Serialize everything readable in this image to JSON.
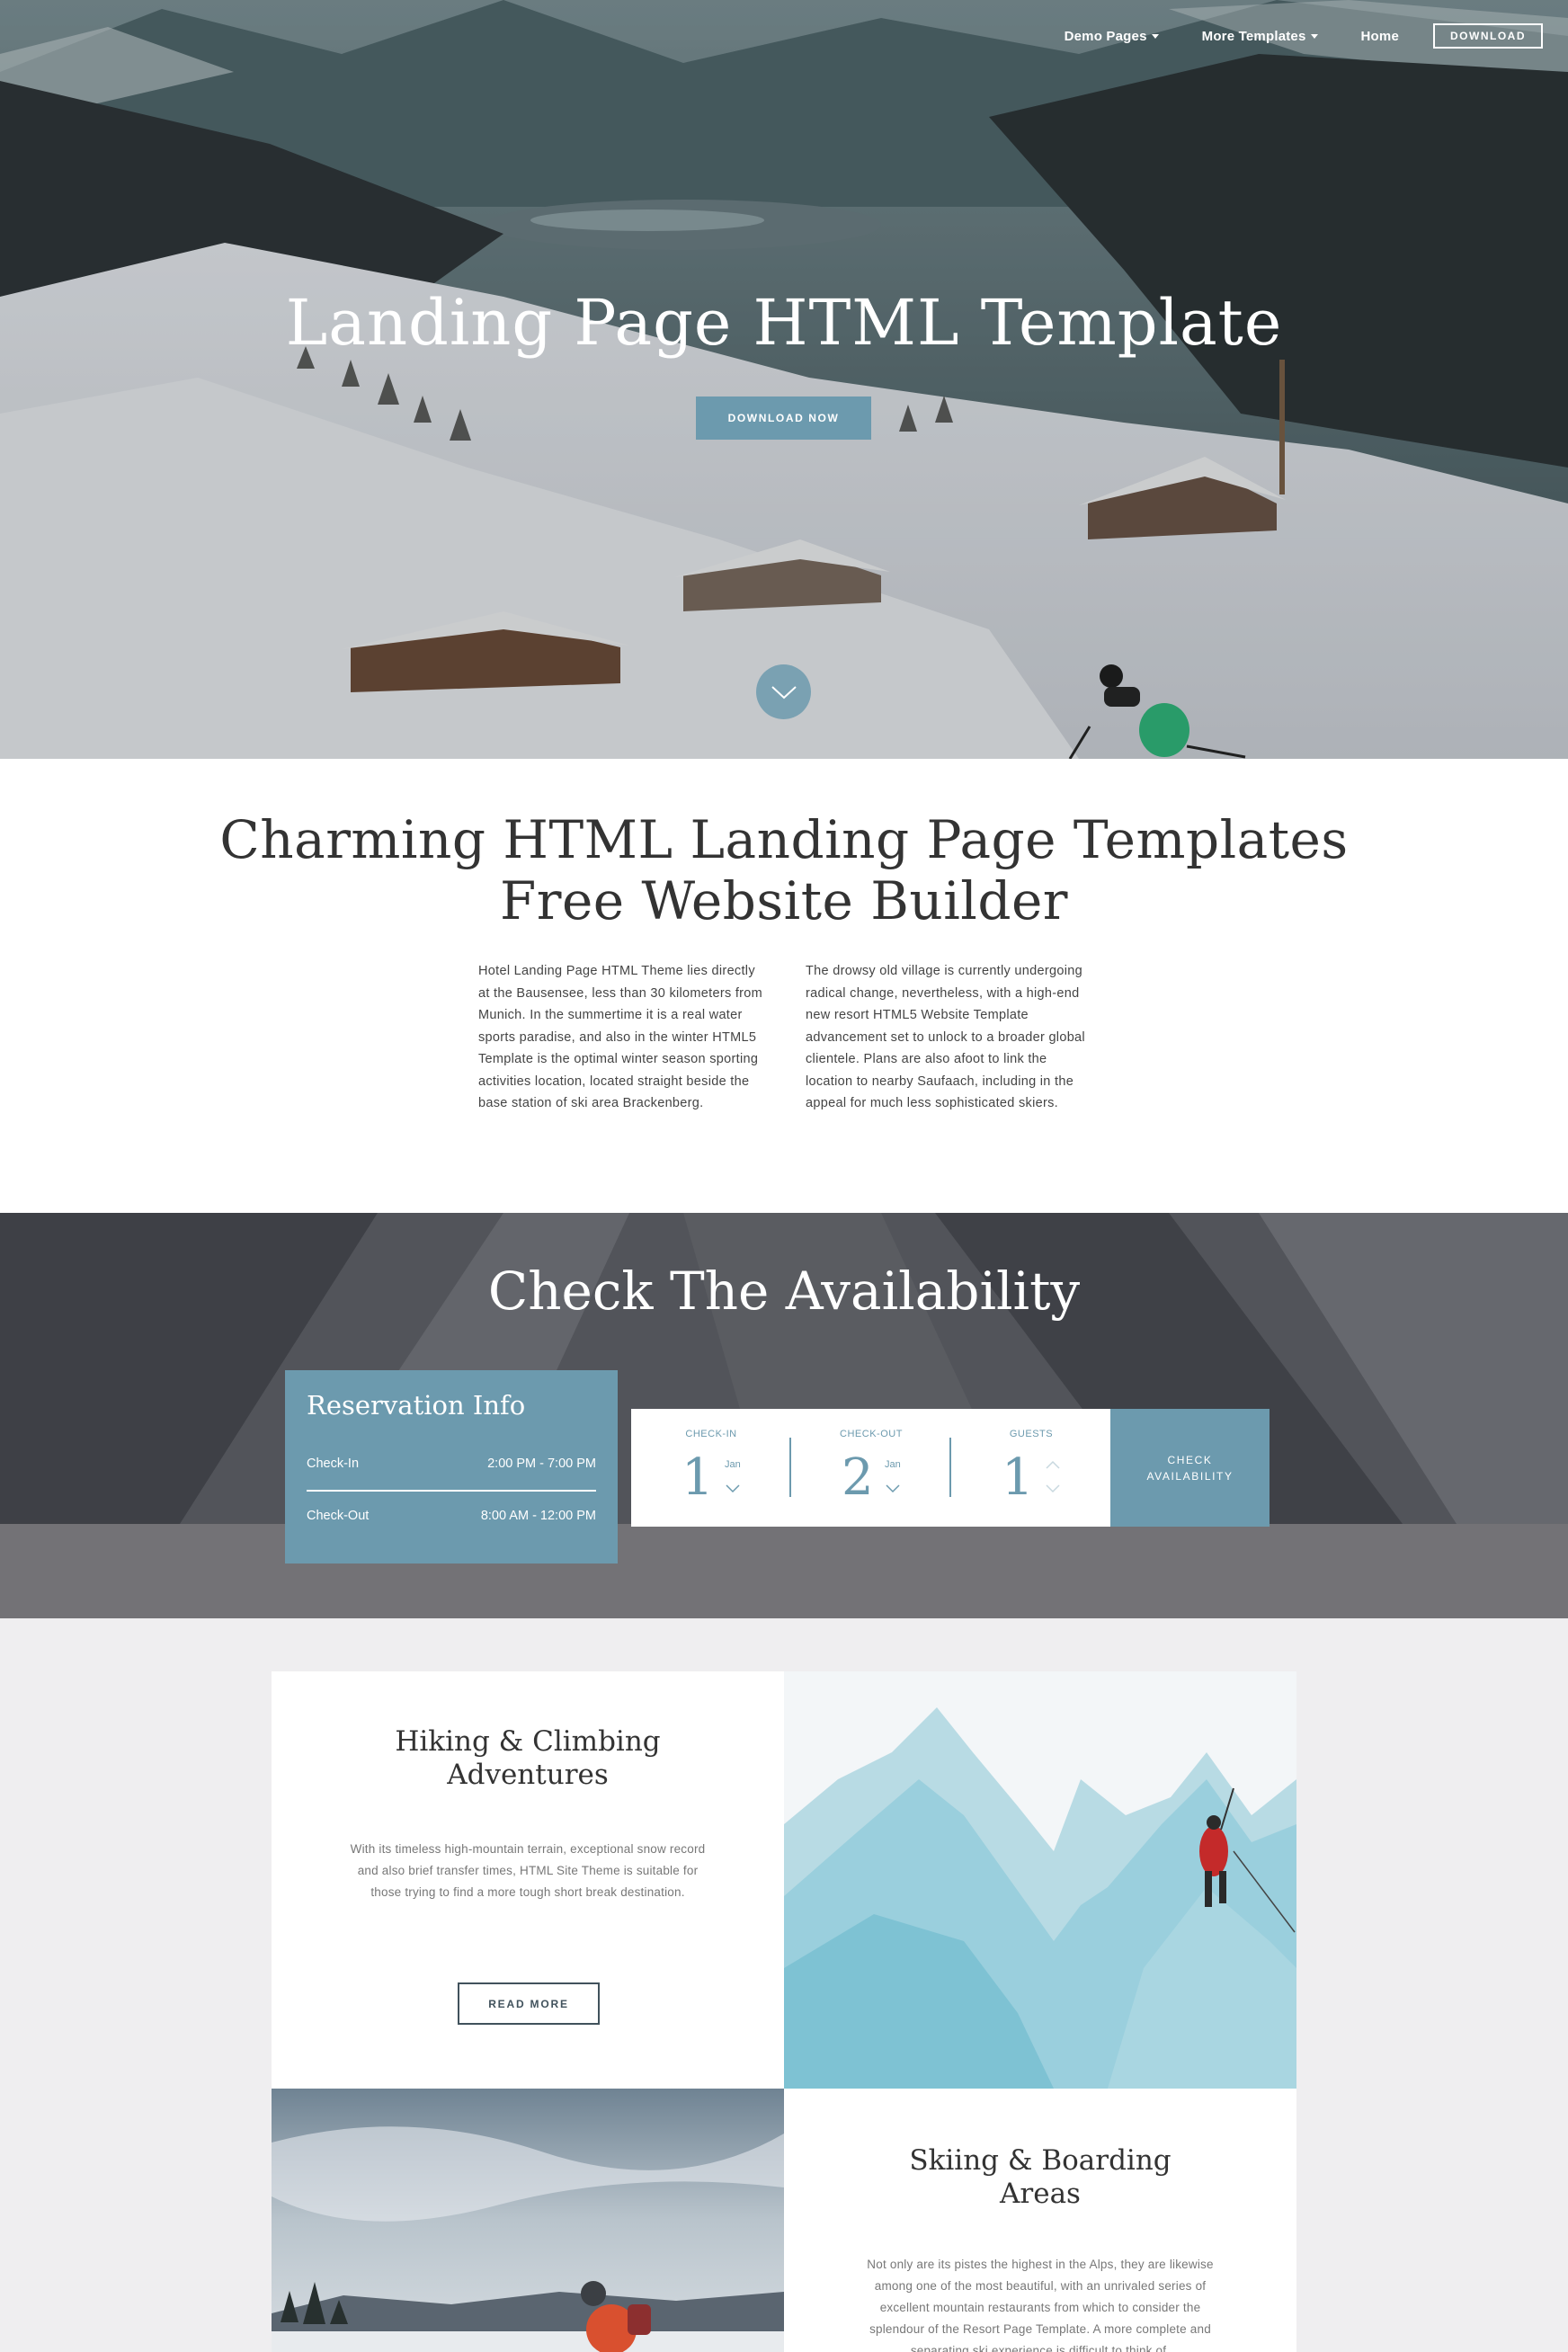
{
  "nav": {
    "items": [
      {
        "label": "Demo Pages",
        "has_caret": true
      },
      {
        "label": "More Templates",
        "has_caret": true
      },
      {
        "label": "Home",
        "has_caret": false
      }
    ],
    "download_label": "DOWNLOAD"
  },
  "hero": {
    "title": "Landing Page HTML Template",
    "button_label": "DOWNLOAD NOW",
    "scroll_icon": "chevron-down-icon"
  },
  "intro": {
    "title_line1": "Charming HTML Landing Page Templates",
    "title_line2": "Free Website Builder",
    "col_left": "Hotel Landing Page HTML Theme lies directly at the Bausensee, less than 30 kilometers from Munich. In the summertime it is a real water sports paradise, and also in the winter HTML5 Template is the optimal winter season sporting activities location, located straight beside the base station of ski area Brackenberg.",
    "col_right": "The drowsy old village is currently undergoing radical change, nevertheless, with a high-end new resort HTML5 Website Template advancement set to unlock to a broader global clientele. Plans are also afoot to link the location to nearby Saufaach, including in the appeal for much less sophisticated skiers."
  },
  "availability": {
    "title": "Check The Availability",
    "reservation": {
      "title": "Reservation Info",
      "checkin_label": "Check-In",
      "checkin_value": "2:00 PM - 7:00 PM",
      "checkout_label": "Check-Out",
      "checkout_value": "8:00 AM - 12:00 PM"
    },
    "form": {
      "checkin": {
        "label": "CHECK-IN",
        "day": "1",
        "month": "Jan"
      },
      "checkout": {
        "label": "CHECK-OUT",
        "day": "2",
        "month": "Jan"
      },
      "guests": {
        "label": "GUESTS",
        "value": "1"
      }
    },
    "button_label_line1": "CHECK",
    "button_label_line2": "AVAILABILITY"
  },
  "features": [
    {
      "title_line1": "Hiking & Climbing",
      "title_line2": "Adventures",
      "text": "With its timeless high-mountain terrain, exceptional snow record and also brief transfer times, HTML Site Theme is suitable for those trying to find a more tough short break destination.",
      "button_label": "READ MORE"
    },
    {
      "title_line1": "Skiing & Boarding",
      "title_line2": "Areas",
      "text": "Not only are its pistes the highest in the Alps, they are likewise among one of the most beautiful, with an unrivaled series of excellent mountain restaurants from which to consider the splendour of the Resort Page Template. A more complete and separating ski experience is difficult to think of."
    }
  ],
  "colors": {
    "accent": "#6c9aae",
    "dark_button_border": "#41525c",
    "page_bg": "#efeef0"
  }
}
